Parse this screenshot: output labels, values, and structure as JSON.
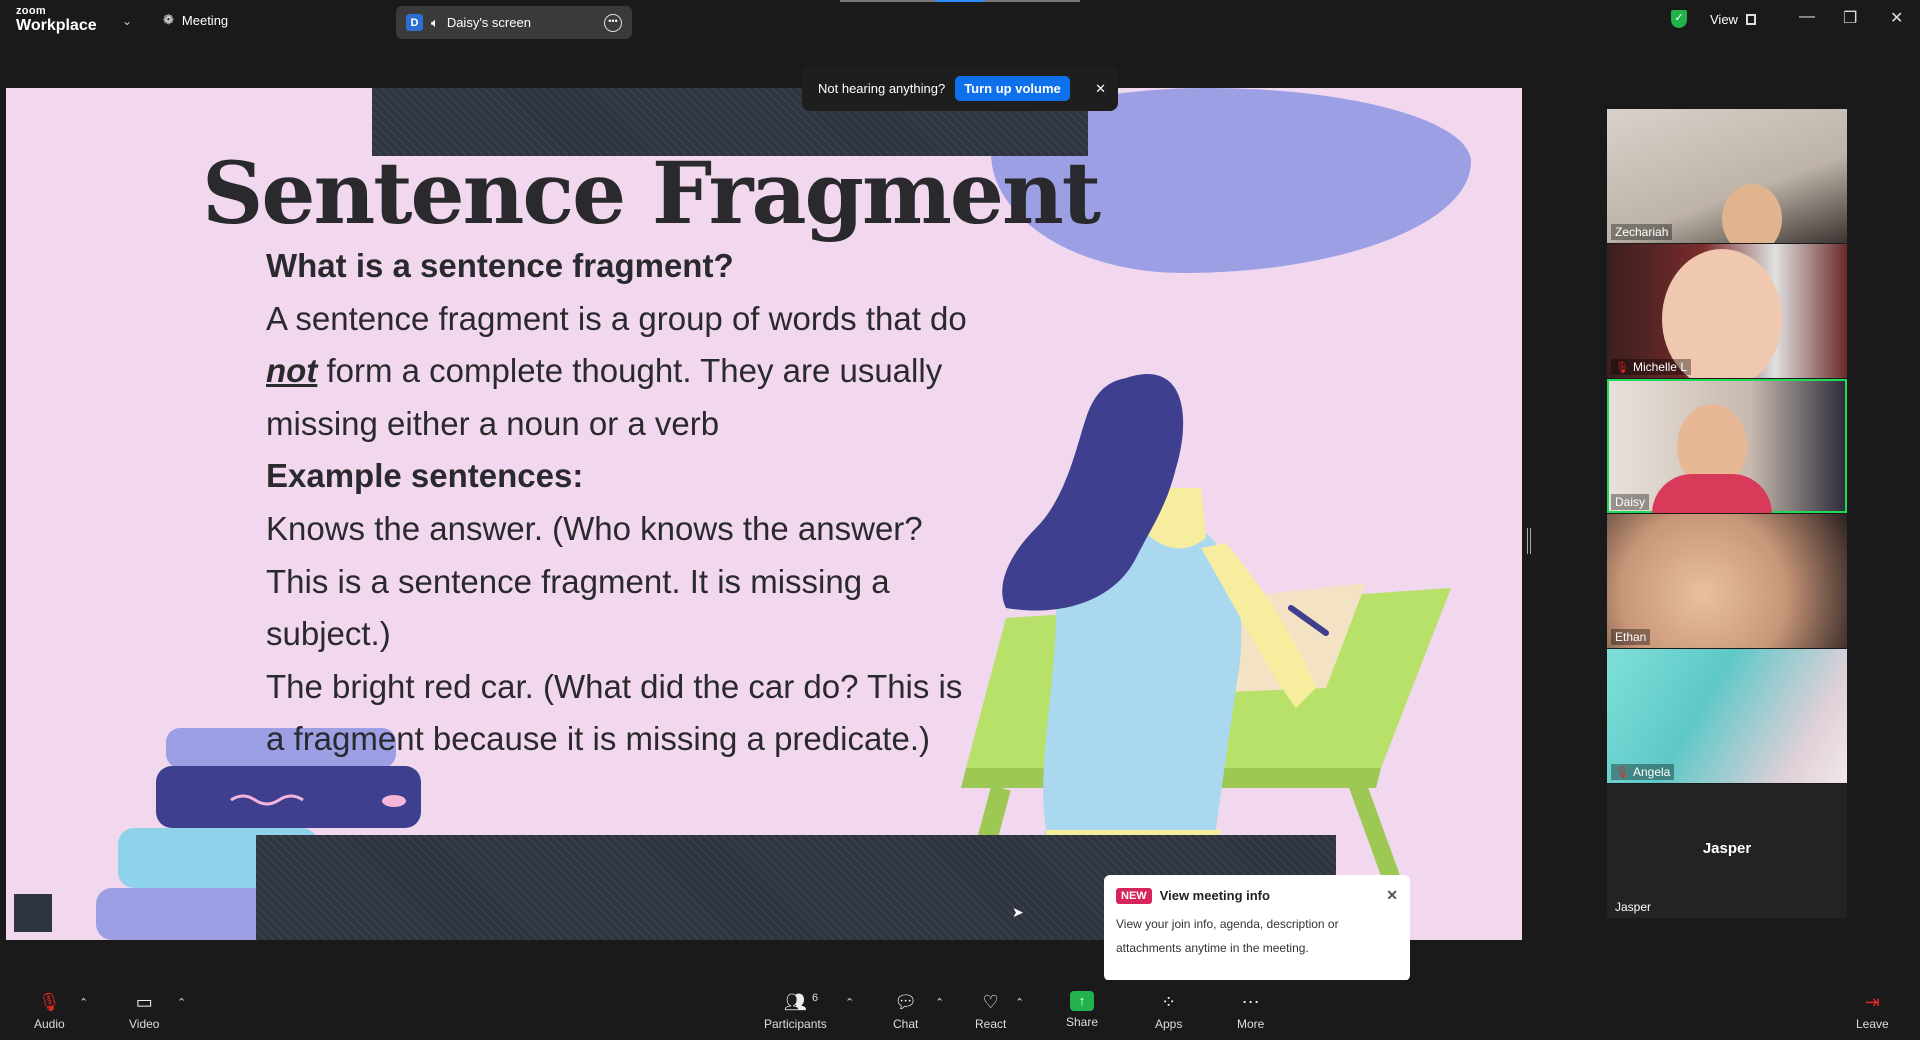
{
  "app": {
    "logo_top": "zoom",
    "logo_bottom": "Workplace",
    "meeting_label": "Meeting"
  },
  "screen_share": {
    "initial": "D",
    "label": "Daisy's screen"
  },
  "view": {
    "label": "View"
  },
  "toast": {
    "text": "Not hearing anything?",
    "button": "Turn up volume"
  },
  "slide": {
    "title": "Sentence Fragment",
    "heading1": "What is a sentence fragment?",
    "def_part1": "A sentence fragment is a group of words that do ",
    "def_emphasis": "not",
    "def_part2": " form a complete thought. They are usually missing either a noun or a verb",
    "heading2": "Example sentences:",
    "example1": "Knows the answer. (Who knows the answer? This is a sentence fragment. It is missing a subject.)",
    "example2": "The bright red car. (What did the car do? This is a fragment because it is missing a predicate.)"
  },
  "gallery": [
    {
      "name": "Zechariah",
      "muted": false
    },
    {
      "name": "Michelle L",
      "muted": true
    },
    {
      "name": "Daisy",
      "muted": false
    },
    {
      "name": "Ethan",
      "muted": false
    },
    {
      "name": "Angela",
      "muted": true
    },
    {
      "name": "Jasper",
      "muted": false,
      "center_label": "Jasper"
    }
  ],
  "info_popup": {
    "badge": "NEW",
    "title": "View meeting info",
    "desc": "View your join info, agenda, description or attachments anytime in the meeting."
  },
  "toolbar": {
    "audio": "Audio",
    "video": "Video",
    "participants": "Participants",
    "participant_count": "6",
    "chat": "Chat",
    "react": "React",
    "share": "Share",
    "apps": "Apps",
    "more": "More",
    "leave": "Leave"
  }
}
